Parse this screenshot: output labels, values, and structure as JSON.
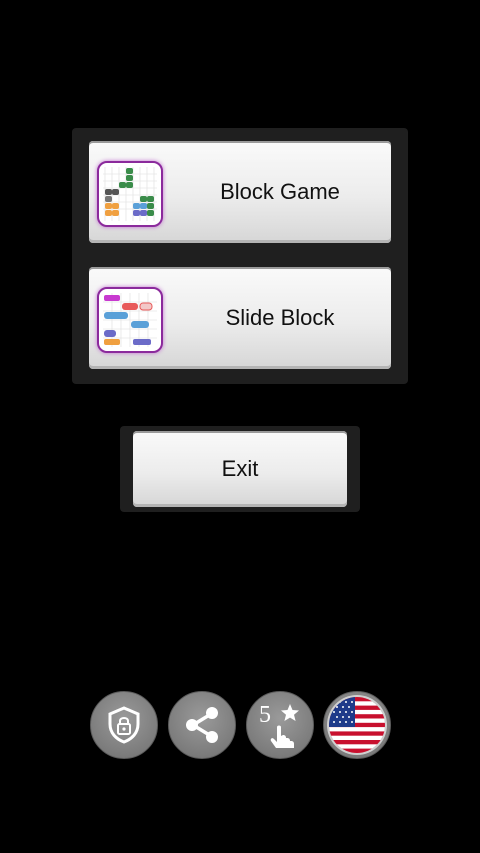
{
  "menu": {
    "games": [
      {
        "label": "Block Game",
        "icon": "block-game-icon"
      },
      {
        "label": "Slide Block",
        "icon": "slide-block-icon"
      }
    ],
    "exit_label": "Exit"
  },
  "footer": {
    "privacy_icon": "privacy-shield-icon",
    "share_icon": "share-icon",
    "rate_number": "5",
    "rate_icon": "rate-star-hand-icon",
    "language_icon": "us-flag-icon"
  },
  "colors": {
    "background": "#000000",
    "panel": "#1f1f1f",
    "button_face": "#ececec",
    "icon_border": "#8b2a9c",
    "round_button": "#7c7c7c"
  }
}
